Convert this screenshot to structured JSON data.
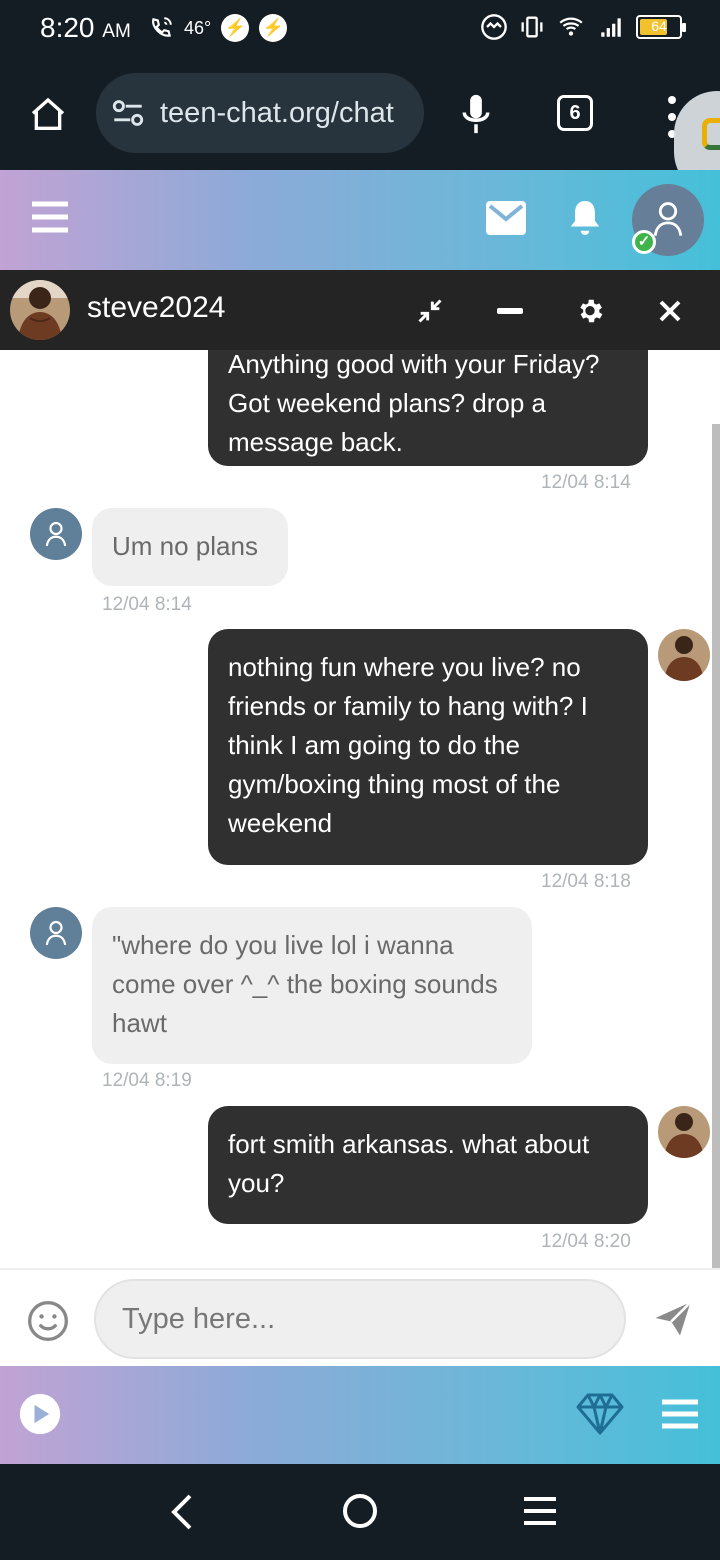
{
  "status_bar": {
    "time": "8:20",
    "meridiem": "AM",
    "temperature": "46°",
    "battery_level": "64"
  },
  "browser": {
    "url": "teen-chat.org/chat",
    "tab_count": "6"
  },
  "chat": {
    "username": "steve2024",
    "messages": [
      {
        "side": "sent",
        "text": "Anything good with your Friday? Got weekend plans? drop a message back.",
        "time": "12/04 8:14"
      },
      {
        "side": "received",
        "text": "Um no plans",
        "time": "12/04 8:14"
      },
      {
        "side": "sent",
        "text": "nothing fun where you live? no friends or family to hang with? I think I am going to do the gym/boxing thing most of the weekend",
        "time": "12/04 8:18"
      },
      {
        "side": "received",
        "text": "\"where do you live lol i wanna come over ^_^ the boxing sounds hawt",
        "time": "12/04 8:19"
      },
      {
        "side": "sent",
        "text": "fort smith arkansas. what about you?",
        "time": "12/04 8:20"
      }
    ]
  },
  "composer": {
    "placeholder": "Type here..."
  },
  "colors": {
    "accent": "#3fb44b",
    "sent_bubble": "#303030",
    "received_bubble": "#efefef",
    "header_gradient_start": "#c1a3d4",
    "header_gradient_end": "#45c0d9"
  },
  "icons": [
    "home-icon",
    "microphone-icon",
    "more-icon",
    "menu-icon",
    "mail-icon",
    "bell-icon",
    "user-icon",
    "minimize-icon",
    "gear-icon",
    "close-icon",
    "emoji-icon",
    "send-icon",
    "play-icon",
    "diamond-icon"
  ]
}
